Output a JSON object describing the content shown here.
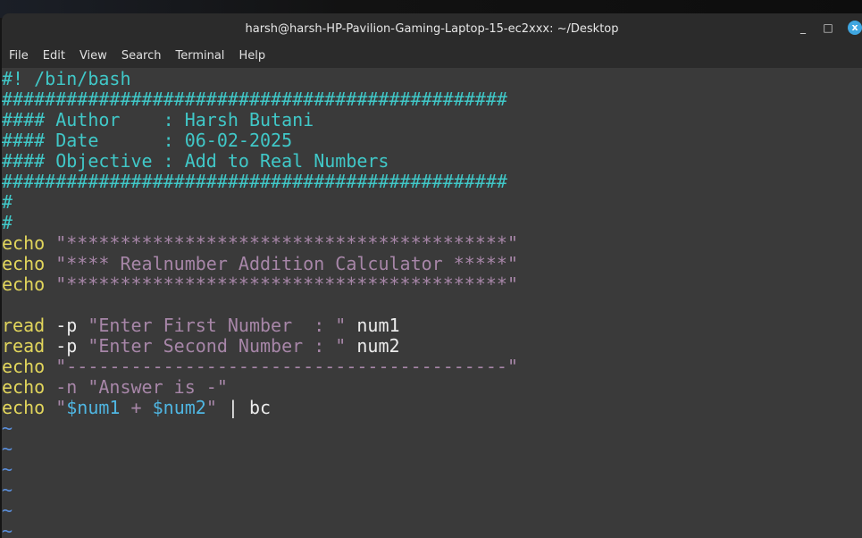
{
  "window": {
    "title": "harsh@harsh-HP-Pavilion-Gaming-Laptop-15-ec2xxx: ~/Desktop",
    "minimize": "_",
    "maximize": "□",
    "close": "x"
  },
  "menu": [
    "File",
    "Edit",
    "View",
    "Search",
    "Terminal",
    "Help"
  ],
  "colors": {
    "comment": "#40c8c8",
    "keyword": "#e2d65c",
    "string": "#a786a8",
    "text": "#ececec",
    "variable": "#4fb6e2",
    "tilde": "#5b8fdc",
    "background": "#3a3a3a"
  },
  "lines": [
    [
      [
        "c",
        "#! /bin/bash"
      ]
    ],
    [
      [
        "c",
        "###############################################"
      ]
    ],
    [
      [
        "c",
        "#### Author    : Harsh Butani"
      ]
    ],
    [
      [
        "c",
        "#### Date      : 06-02-2025"
      ]
    ],
    [
      [
        "c",
        "#### Objective : Add to Real Numbers"
      ]
    ],
    [
      [
        "c",
        "###############################################"
      ]
    ],
    [
      [
        "c",
        "#"
      ]
    ],
    [
      [
        "c",
        "#"
      ]
    ],
    [
      [
        "k",
        "echo"
      ],
      [
        "w",
        " "
      ],
      [
        "s",
        "\"*****************************************\""
      ]
    ],
    [
      [
        "k",
        "echo"
      ],
      [
        "w",
        " "
      ],
      [
        "s",
        "\"**** Realnumber Addition Calculator *****\""
      ]
    ],
    [
      [
        "k",
        "echo"
      ],
      [
        "w",
        " "
      ],
      [
        "s",
        "\"*****************************************\""
      ]
    ],
    [],
    [
      [
        "k",
        "read"
      ],
      [
        "w",
        " -p "
      ],
      [
        "s",
        "\"Enter First Number  : \""
      ],
      [
        "w",
        " num1"
      ]
    ],
    [
      [
        "k",
        "read"
      ],
      [
        "w",
        " -p "
      ],
      [
        "s",
        "\"Enter Second Number : \""
      ],
      [
        "w",
        " num2"
      ]
    ],
    [
      [
        "k",
        "echo"
      ],
      [
        "w",
        " "
      ],
      [
        "s",
        "\"-----------------------------------------\""
      ]
    ],
    [
      [
        "k",
        "echo"
      ],
      [
        "s",
        " -n \"Answer is -\""
      ]
    ],
    [
      [
        "k",
        "echo"
      ],
      [
        "w",
        " "
      ],
      [
        "s",
        "\""
      ],
      [
        "v",
        "$num1"
      ],
      [
        "s",
        " + "
      ],
      [
        "v",
        "$num2"
      ],
      [
        "s",
        "\""
      ],
      [
        "w",
        " | bc"
      ]
    ],
    [
      [
        "t",
        "~"
      ]
    ],
    [
      [
        "t",
        "~"
      ]
    ],
    [
      [
        "t",
        "~"
      ]
    ],
    [
      [
        "t",
        "~"
      ]
    ],
    [
      [
        "t",
        "~"
      ]
    ],
    [
      [
        "t",
        "~"
      ]
    ]
  ]
}
